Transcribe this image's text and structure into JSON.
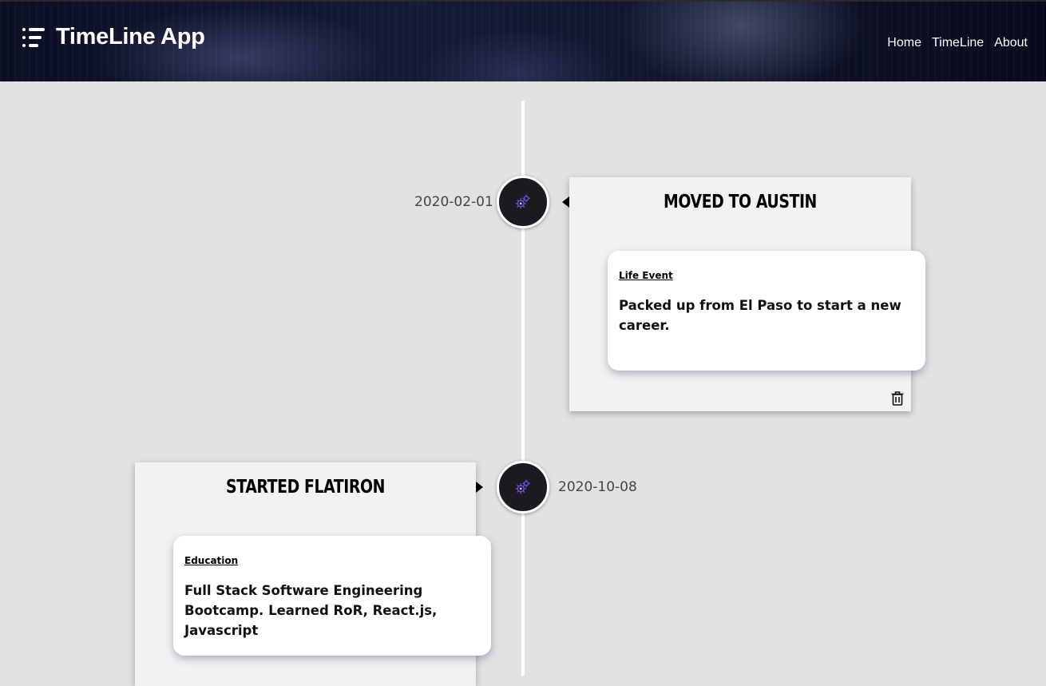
{
  "header": {
    "app_title": "TimeLine App",
    "menu_icon": "list-icon",
    "nav": [
      "Home",
      "TimeLine",
      "About"
    ]
  },
  "colors": {
    "page_background": "#e2e2e2",
    "node_background": "#1b1b1f",
    "node_icon_accent": "#6b4bd8",
    "timeline_spine": "#ffffff"
  },
  "events": [
    {
      "date": "2020-02-01",
      "title": "Moved to Austin",
      "category": "Life Event",
      "description": "Packed up from El Paso to start a new career.",
      "icon": "gears-icon",
      "action_icon": "trash-icon"
    },
    {
      "date": "2020-10-08",
      "title": "Started Flatiron",
      "category": "Education",
      "description": "Full Stack Software Engineering Bootcamp. Learned RoR, React.js, Javascript",
      "icon": "gears-icon"
    }
  ]
}
